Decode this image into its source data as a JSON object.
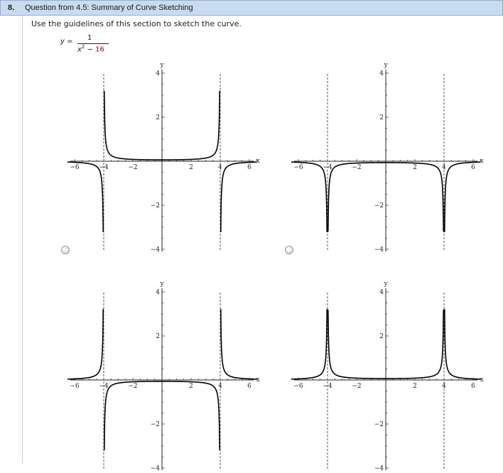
{
  "header": {
    "number": "8.",
    "title": "Question from 4.5: Summary of Curve Sketching"
  },
  "instructions": "Use the guidelines of this section to sketch the curve.",
  "equation": {
    "lhs": "y =",
    "numerator": "1",
    "den_var": "x",
    "den_exp": "2",
    "den_minus": " − ",
    "den_const": "16"
  },
  "colors": {
    "header_bg": "#c9dcef",
    "header_border": "#8fb0d2",
    "highlight_red": "#c0001a",
    "curve": "#000000"
  },
  "axis_labels": {
    "x": "x",
    "y": "y"
  },
  "x_ticks": [
    {
      "v": -6,
      "t": "−6"
    },
    {
      "v": -4,
      "t": "−4"
    },
    {
      "v": -2,
      "t": "−2"
    },
    {
      "v": 2,
      "t": "2"
    },
    {
      "v": 4,
      "t": "4"
    },
    {
      "v": 6,
      "t": "6"
    }
  ],
  "y_ticks": [
    {
      "v": 4,
      "t": "4"
    },
    {
      "v": 2,
      "t": "2"
    },
    {
      "v": -2,
      "t": "−2"
    },
    {
      "v": -4,
      "t": "−4"
    }
  ],
  "options": [
    {
      "id": "option-1",
      "variant": "a",
      "selected": false
    },
    {
      "id": "option-2",
      "variant": "b",
      "selected": false
    },
    {
      "id": "option-3",
      "variant": "c",
      "selected": false
    },
    {
      "id": "option-4",
      "variant": "d",
      "selected": false
    }
  ],
  "chart_data": [
    {
      "type": "line",
      "title": "",
      "xlabel": "x",
      "ylabel": "y",
      "xlim": [
        -6.8,
        6.8
      ],
      "ylim": [
        -4.2,
        4.2
      ],
      "asymptotes_x": [
        -4,
        4
      ],
      "curve": "y = 1/(16 - x^2)"
    },
    {
      "type": "line",
      "title": "",
      "xlabel": "x",
      "ylabel": "y",
      "xlim": [
        -6.8,
        6.8
      ],
      "ylim": [
        -4.2,
        4.2
      ],
      "asymptotes_x": [
        -4,
        4
      ],
      "curve": "y = -1/|x^2 - 16|"
    },
    {
      "type": "line",
      "title": "",
      "xlabel": "x",
      "ylabel": "y",
      "xlim": [
        -6.8,
        6.8
      ],
      "ylim": [
        -4.2,
        4.2
      ],
      "asymptotes_x": [
        -4,
        4
      ],
      "curve": "y = 1/(x^2 - 16)"
    },
    {
      "type": "line",
      "title": "",
      "xlabel": "x",
      "ylabel": "y",
      "xlim": [
        -6.8,
        6.8
      ],
      "ylim": [
        -4.2,
        4.2
      ],
      "asymptotes_x": [
        -4,
        4
      ],
      "curve": "y = 1/|x^2 - 16|"
    }
  ]
}
